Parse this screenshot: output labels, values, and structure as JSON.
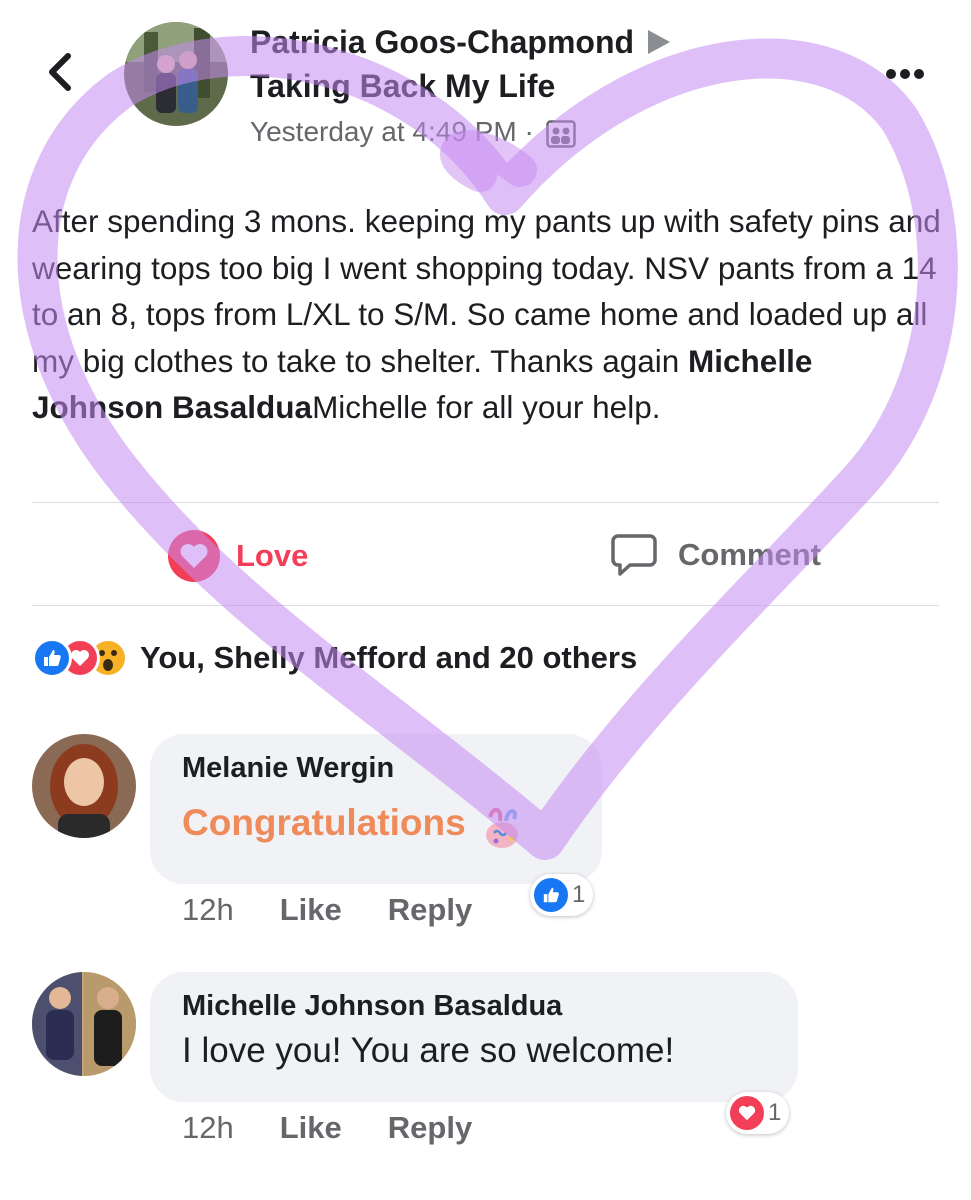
{
  "header": {
    "author": "Patricia Goos-Chapmond",
    "group": "Taking Back My Life",
    "timestamp": "Yesterday at 4:49 PM",
    "separator": "·"
  },
  "post": {
    "text_before": "After spending 3 mons. keeping my pants up with safety pins and wearing tops too big I went shopping today.  NSV pants from a 14 to an 8, tops from L/XL to S/M.  So came home and loaded up all my big clothes to take to shelter.  Thanks again ",
    "mention": "Michelle Johnson Basaldua",
    "text_after": "Michelle for all your help."
  },
  "actions": {
    "love_label": "Love",
    "comment_label": "Comment"
  },
  "reactions": {
    "summary": "You, Shelly Mefford and 20 others"
  },
  "comments": [
    {
      "name": "Melanie Wergin",
      "text": "Congratulations",
      "time": "12h",
      "like": "Like",
      "reply": "Reply",
      "reaction_count": "1"
    },
    {
      "name": "Michelle Johnson Basaldua",
      "text": "I love you! You are so welcome!",
      "time": "12h",
      "like": "Like",
      "reply": "Reply",
      "reaction_count": "1"
    }
  ],
  "colors": {
    "love": "#f33e58",
    "like": "#1877f2",
    "wow": "#f7b125",
    "overlay": "#c58af0",
    "congrats": "#ef8a5b"
  }
}
